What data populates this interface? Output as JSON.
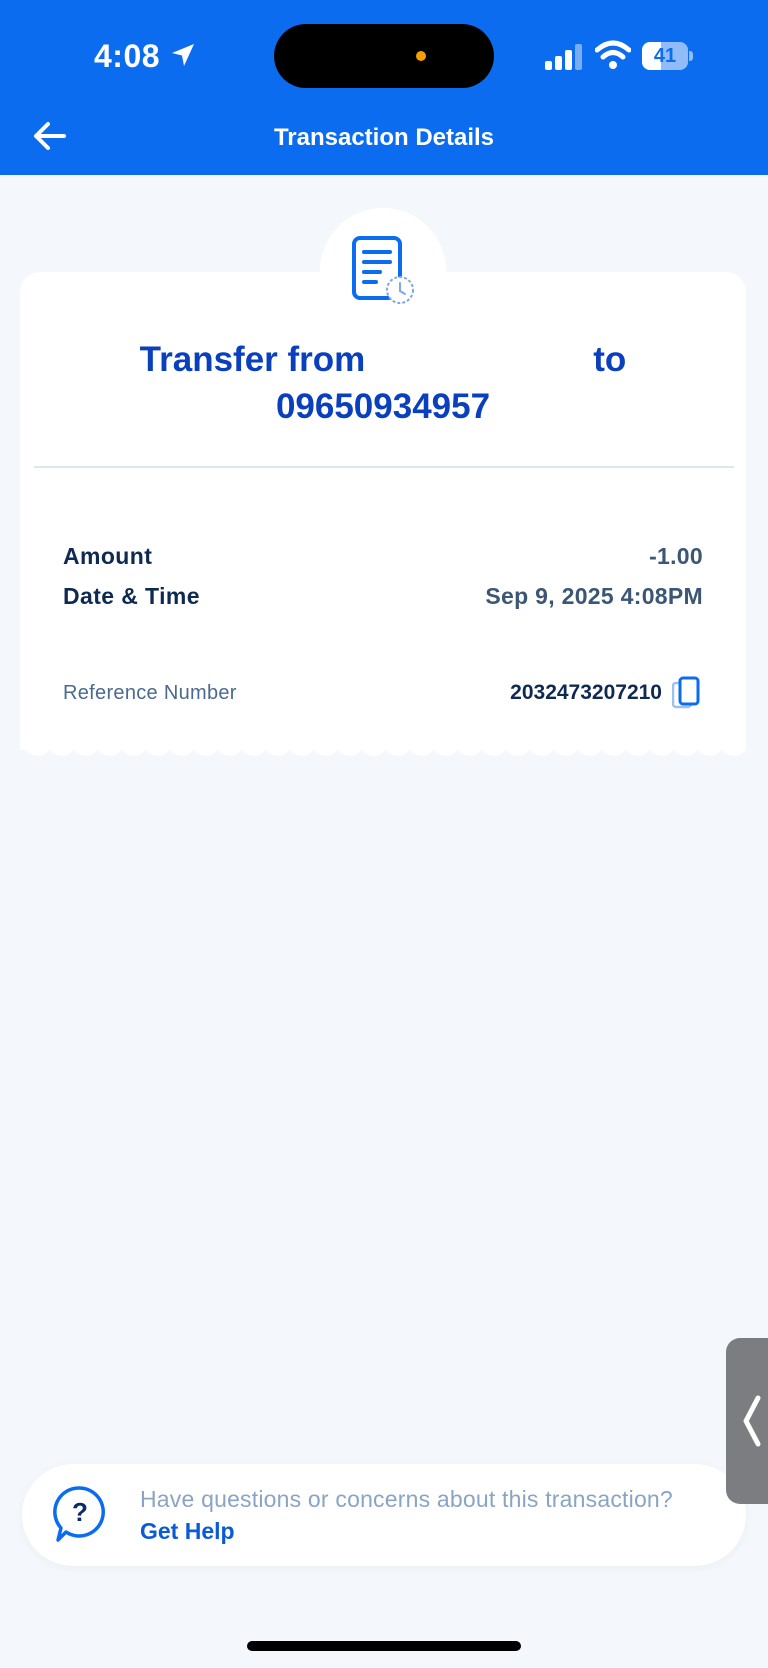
{
  "status_bar": {
    "time": "4:08",
    "battery_level": "41",
    "battery_fraction": 0.41
  },
  "nav": {
    "title": "Transaction Details",
    "back_icon": "arrow-left-icon"
  },
  "transaction": {
    "title_from": "Transfer from",
    "title_to": "to",
    "recipient_number": "09650934957",
    "details": [
      {
        "label": "Amount",
        "value": "-1.00"
      },
      {
        "label": "Date & Time",
        "value": "Sep 9, 2025 4:08PM"
      }
    ],
    "reference": {
      "label": "Reference Number",
      "value": "2032473207210"
    }
  },
  "help": {
    "question": "Have questions or concerns about this transaction?",
    "link_label": "Get Help"
  },
  "colors": {
    "brand_blue": "#0b6cf0",
    "title_blue": "#0a3fbd",
    "background": "#f4f8fc"
  }
}
